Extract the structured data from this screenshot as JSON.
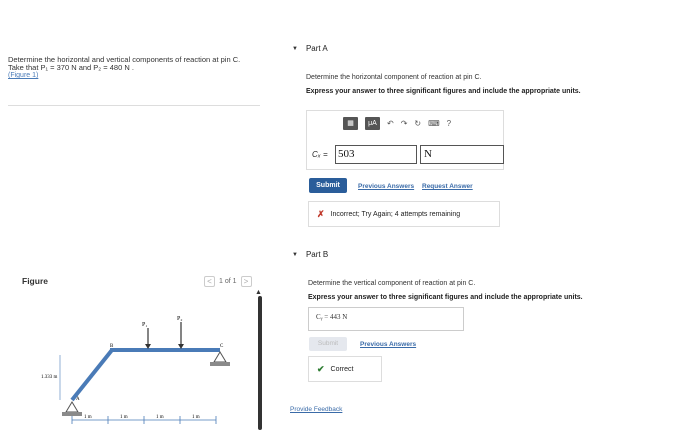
{
  "problem": {
    "line1": "Determine the horizontal and vertical components of reaction at pin C.",
    "line2": "Take that P₁ = 370 N and P₂ = 480 N .",
    "figure_link": "(Figure 1)"
  },
  "figure": {
    "label": "Figure",
    "pager": "1 of 1",
    "prev": "<",
    "next": ">",
    "p1": "P₁",
    "p2": "P₂",
    "height_label": "1.333 m",
    "label_A": "A",
    "label_B": "B",
    "label_C": "C",
    "spans": [
      "1 m",
      "1 m",
      "1 m",
      "1 m"
    ]
  },
  "partA": {
    "title": "Part A",
    "prompt": "Determine the horizontal component of reaction at pin C.",
    "instruction": "Express your answer to three significant figures and include the appropriate units.",
    "toolbar": {
      "templates": "▦",
      "mu_a": "μA",
      "help": "?"
    },
    "field_label": "Cₓ =",
    "value": "503",
    "unit": "N",
    "submit": "Submit",
    "previous_answers": "Previous Answers",
    "request_answer": "Request Answer",
    "feedback": "Incorrect; Try Again; 4 attempts remaining"
  },
  "partB": {
    "title": "Part B",
    "prompt": "Determine the vertical component of reaction at pin C.",
    "instruction": "Express your answer to three significant figures and include the appropriate units.",
    "answer": "Cᵧ = 443 N",
    "submit": "Submit",
    "previous_answers": "Previous Answers",
    "feedback": "Correct"
  },
  "footer": {
    "provide_feedback": "Provide Feedback"
  }
}
